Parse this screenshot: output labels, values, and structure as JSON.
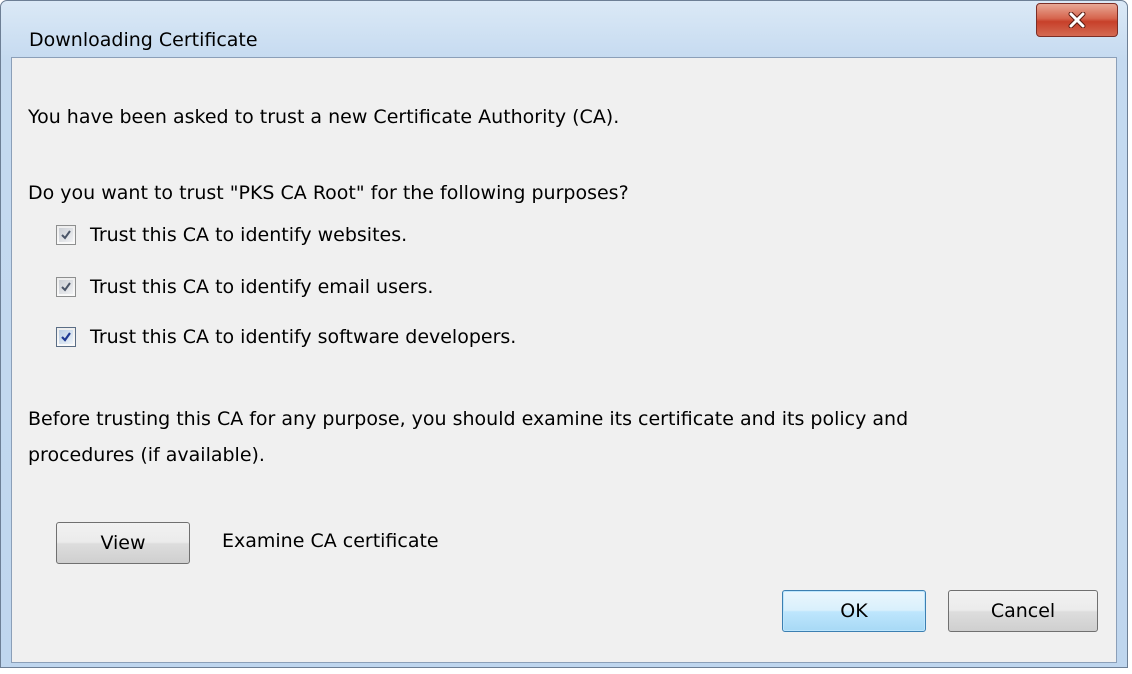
{
  "dialog": {
    "title": "Downloading Certificate",
    "close_label": "X",
    "intro": "You have been asked to trust a new Certificate Authority (CA).",
    "question": "Do you want to trust \"PKS CA Root\" for the following purposes?",
    "checkboxes": [
      {
        "label": "Trust this CA to identify websites.",
        "checked": true,
        "enabled": false
      },
      {
        "label": "Trust this CA to identify email users.",
        "checked": true,
        "enabled": false
      },
      {
        "label": "Trust this CA to identify software developers.",
        "checked": true,
        "enabled": true
      }
    ],
    "advice_line1": "Before trusting this CA for any purpose, you should examine its certificate and its policy and",
    "advice_line2": "procedures (if available).",
    "view_button": "View",
    "view_description": "Examine CA certificate",
    "ok_button": "OK",
    "cancel_button": "Cancel"
  },
  "icons": {
    "close": "close-icon",
    "check": "checkmark-icon"
  },
  "colors": {
    "close_button": "#c7402a",
    "dialog_background": "#f0f0f0",
    "frame": "#c5daf0",
    "default_button_border": "#3c7fb1"
  }
}
